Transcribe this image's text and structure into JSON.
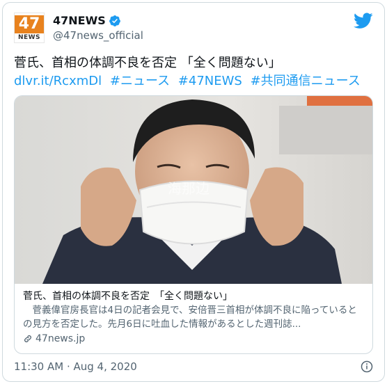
{
  "account": {
    "avatar_number": "47",
    "avatar_brand": "NEWS",
    "display_name": "47NEWS",
    "handle": "@47news_official",
    "verified_icon": "verified-badge-icon"
  },
  "tweet": {
    "text": "菅氏、首相の体調不良を否定 「全く問題ない」",
    "links": [
      "dlvr.it/RcxmDl",
      "#ニュース",
      "#47NEWS",
      "#共同通信ニュース"
    ]
  },
  "card": {
    "image_desc": "photo",
    "title": "菅氏、首相の体調不良を否定　「全く問題ない」",
    "description": "　菅義偉官房長官は4日の記者会見で、安倍晋三首相が体調不良に陥っているとの見方を否定した。先月6日に吐血した情報があるとした週刊誌...",
    "domain": "47news.jp"
  },
  "footer": {
    "timestamp": "11:30 AM · Aug 4, 2020"
  },
  "colors": {
    "link": "#1d9bf0",
    "brand_orange": "#e8821e",
    "secondary_text": "#536471"
  }
}
